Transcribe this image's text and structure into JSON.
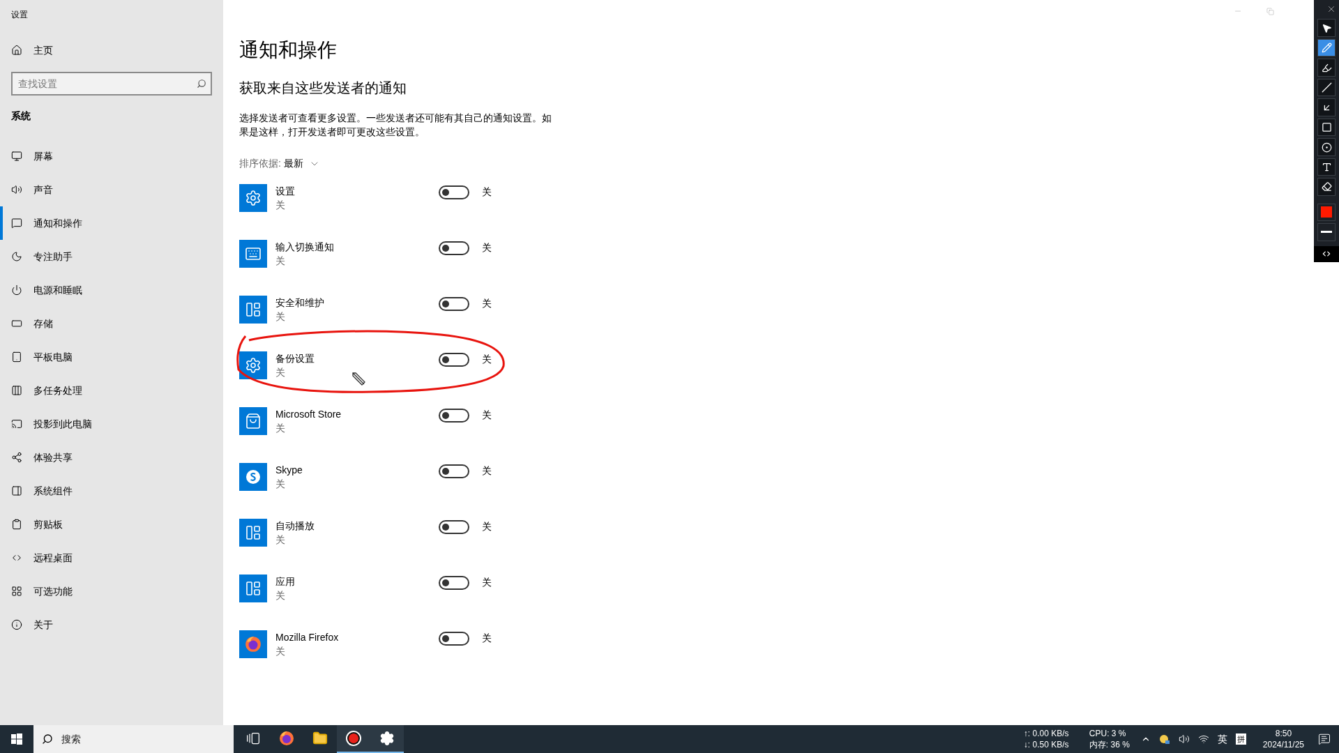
{
  "window": {
    "title": "设置"
  },
  "sidebar": {
    "home": "主页",
    "search": {
      "placeholder": "查找设置"
    },
    "section": "系统",
    "items": [
      {
        "label": "屏幕",
        "selected": false
      },
      {
        "label": "声音",
        "selected": false
      },
      {
        "label": "通知和操作",
        "selected": true
      },
      {
        "label": "专注助手",
        "selected": false
      },
      {
        "label": "电源和睡眠",
        "selected": false
      },
      {
        "label": "存储",
        "selected": false
      },
      {
        "label": "平板电脑",
        "selected": false
      },
      {
        "label": "多任务处理",
        "selected": false
      },
      {
        "label": "投影到此电脑",
        "selected": false
      },
      {
        "label": "体验共享",
        "selected": false
      },
      {
        "label": "系统组件",
        "selected": false
      },
      {
        "label": "剪贴板",
        "selected": false
      },
      {
        "label": "远程桌面",
        "selected": false
      },
      {
        "label": "可选功能",
        "selected": false
      },
      {
        "label": "关于",
        "selected": false
      }
    ]
  },
  "main": {
    "title": "通知和操作",
    "subtitle": "获取来自这些发送者的通知",
    "description": "选择发送者可查看更多设置。一些发送者还可能有其自己的通知设置。如果是这样，打开发送者即可更改这些设置。",
    "sort": {
      "label": "排序依据:",
      "value": "最新"
    },
    "senders": [
      {
        "name": "设置",
        "status": "关",
        "on": false,
        "toggle_label": "关"
      },
      {
        "name": "输入切换通知",
        "status": "关",
        "on": false,
        "toggle_label": "关"
      },
      {
        "name": "安全和维护",
        "status": "关",
        "on": false,
        "toggle_label": "关"
      },
      {
        "name": "备份设置",
        "status": "关",
        "on": false,
        "toggle_label": "关"
      },
      {
        "name": "Microsoft Store",
        "status": "关",
        "on": false,
        "toggle_label": "关"
      },
      {
        "name": "Skype",
        "status": "关",
        "on": false,
        "toggle_label": "关"
      },
      {
        "name": "自动播放",
        "status": "关",
        "on": false,
        "toggle_label": "关"
      },
      {
        "name": "应用",
        "status": "关",
        "on": false,
        "toggle_label": "关"
      },
      {
        "name": "Mozilla Firefox",
        "status": "关",
        "on": false,
        "toggle_label": "关"
      }
    ]
  },
  "annotation_toolbar": {
    "tools": [
      {
        "selected": false
      },
      {
        "selected": true
      },
      {
        "selected": false
      },
      {
        "selected": false
      },
      {
        "selected": false
      },
      {
        "selected": false
      },
      {
        "selected": false
      },
      {
        "selected": false
      },
      {
        "selected": false
      }
    ]
  },
  "taskbar": {
    "search": {
      "placeholder": "搜索"
    },
    "apps": [
      {
        "active": false
      },
      {
        "active": false
      },
      {
        "active": false
      },
      {
        "active": true
      },
      {
        "active": true
      }
    ],
    "tray": {
      "net_up": "↑: 0.00 KB/s",
      "net_down": "↓: 0.50 KB/s",
      "cpu": "CPU: 3 %",
      "memory": "内存: 36 %",
      "ime_language": "英",
      "ime_mode": "拼",
      "time": "8:50",
      "date": "2024/11/25"
    }
  }
}
